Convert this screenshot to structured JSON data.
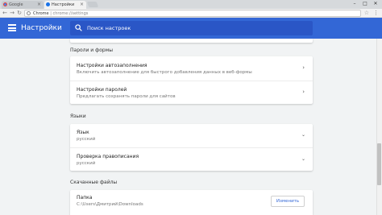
{
  "browser": {
    "tabs": [
      {
        "label": "Google",
        "active": false
      },
      {
        "label": "Настройки",
        "active": true
      }
    ],
    "address": {
      "scheme": "Chrome",
      "separator": " | ",
      "url": "chrome://settings"
    },
    "window_controls": {
      "minimize": "–",
      "maximize": "□",
      "close": "✕"
    }
  },
  "header": {
    "title": "Настройки",
    "search_placeholder": "Поиск настроек",
    "color": "#3367d6"
  },
  "sections": {
    "passwords_forms": {
      "title": "Пароли и формы",
      "autofill": {
        "label": "Настройки автозаполнения",
        "sub": "Включить автозаполнение для быстрого добавления данных в веб-формы"
      },
      "passwords": {
        "label": "Настройки паролей",
        "sub": "Предлагать сохранять пароли для сайтов"
      }
    },
    "languages": {
      "title": "Языки",
      "language": {
        "label": "Язык",
        "value": "русский"
      },
      "spellcheck": {
        "label": "Проверка правописания",
        "value": "русский"
      }
    },
    "downloads": {
      "title": "Скачанные файлы",
      "folder": {
        "label": "Папка",
        "path": "C:\\Users\\Дмитрий\\Downloads",
        "button": "Изменить"
      }
    }
  }
}
